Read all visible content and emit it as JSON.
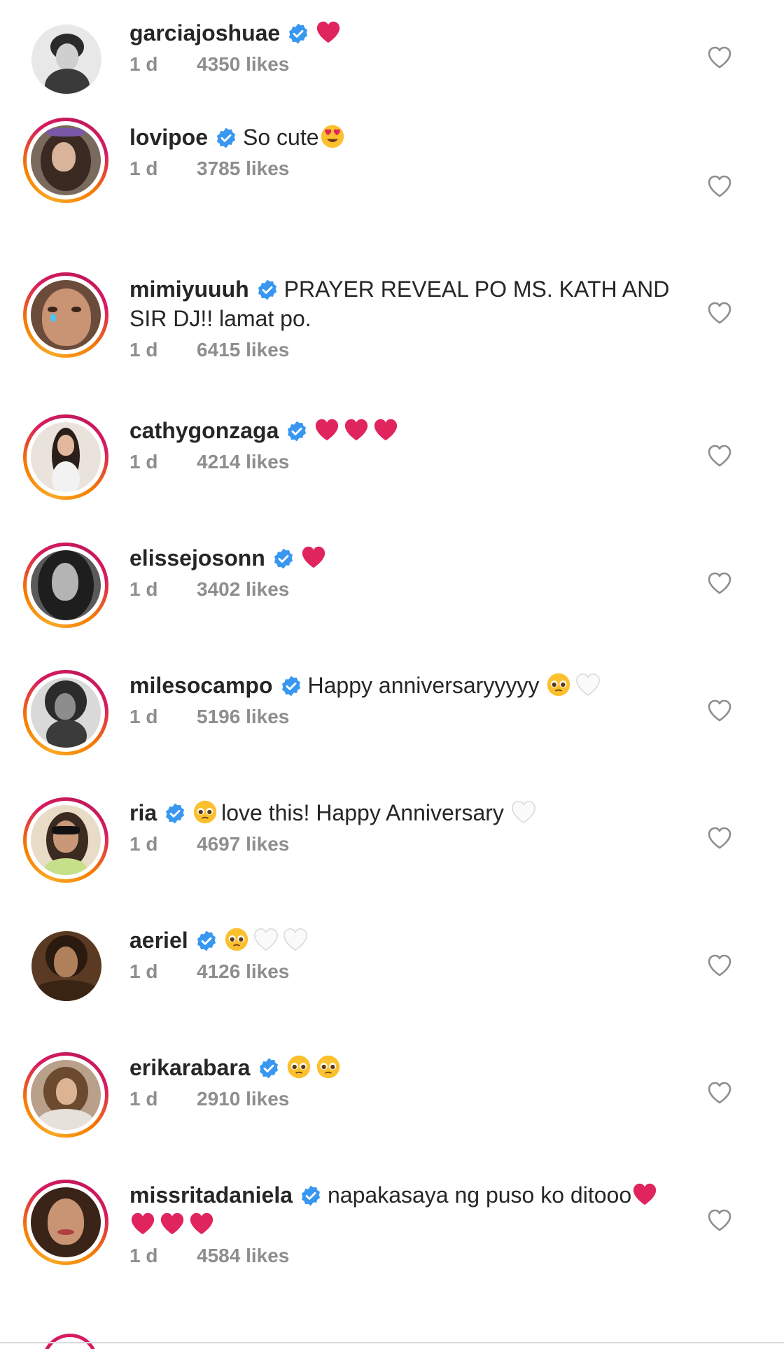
{
  "comments": [
    {
      "username": "garciajoshuae",
      "text": "",
      "emoji": [
        "red-heart"
      ],
      "time": "1 d",
      "likes": "4350 likes",
      "story": false
    },
    {
      "username": "lovipoe",
      "text": "So cute",
      "emoji": [
        "heart-eyes"
      ],
      "time": "1 d",
      "likes": "3785 likes",
      "story": true
    },
    {
      "username": "mimiyuuuh",
      "text": "PRAYER REVEAL PO MS. KATH AND SIR DJ!! lamat po.",
      "emoji": [],
      "time": "1 d",
      "likes": "6415 likes",
      "story": true
    },
    {
      "username": "cathygonzaga",
      "text": "",
      "emoji": [
        "red-heart",
        "red-heart",
        "red-heart"
      ],
      "time": "1 d",
      "likes": "4214 likes",
      "story": true
    },
    {
      "username": "elissejosonn",
      "text": "",
      "emoji": [
        "red-heart"
      ],
      "time": "1 d",
      "likes": "3402 likes",
      "story": true
    },
    {
      "username": "milesocampo",
      "text": "Happy anniversaryyyyy",
      "emoji": [
        "pleading-face",
        "white-heart"
      ],
      "time": "1 d",
      "likes": "5196 likes",
      "story": true
    },
    {
      "username": "ria",
      "text": "love this! Happy Anniversary",
      "emoji_before": [
        "pleading-face"
      ],
      "emoji": [
        "white-heart"
      ],
      "time": "1 d",
      "likes": "4697 likes",
      "story": true
    },
    {
      "username": "aeriel",
      "text": "",
      "emoji": [
        "pleading-face",
        "white-heart",
        "white-heart"
      ],
      "time": "1 d",
      "likes": "4126 likes",
      "story": false
    },
    {
      "username": "erikarabara",
      "text": "",
      "emoji": [
        "pleading-face",
        "pleading-face"
      ],
      "time": "1 d",
      "likes": "2910 likes",
      "story": true
    },
    {
      "username": "missritadaniela",
      "text": "napakasaya ng puso ko ditooo",
      "emoji": [
        "red-heart",
        "red-heart",
        "red-heart",
        "red-heart"
      ],
      "time": "1 d",
      "likes": "4584 likes",
      "story": true
    }
  ],
  "colors": {
    "verified_badge": "#3897f0",
    "meta_text": "#8e8e8e",
    "story_ring": "#d81b60",
    "heart_red": "#e0245e"
  },
  "icons": {
    "verified": "verified-badge-icon",
    "like": "heart-outline-icon"
  }
}
